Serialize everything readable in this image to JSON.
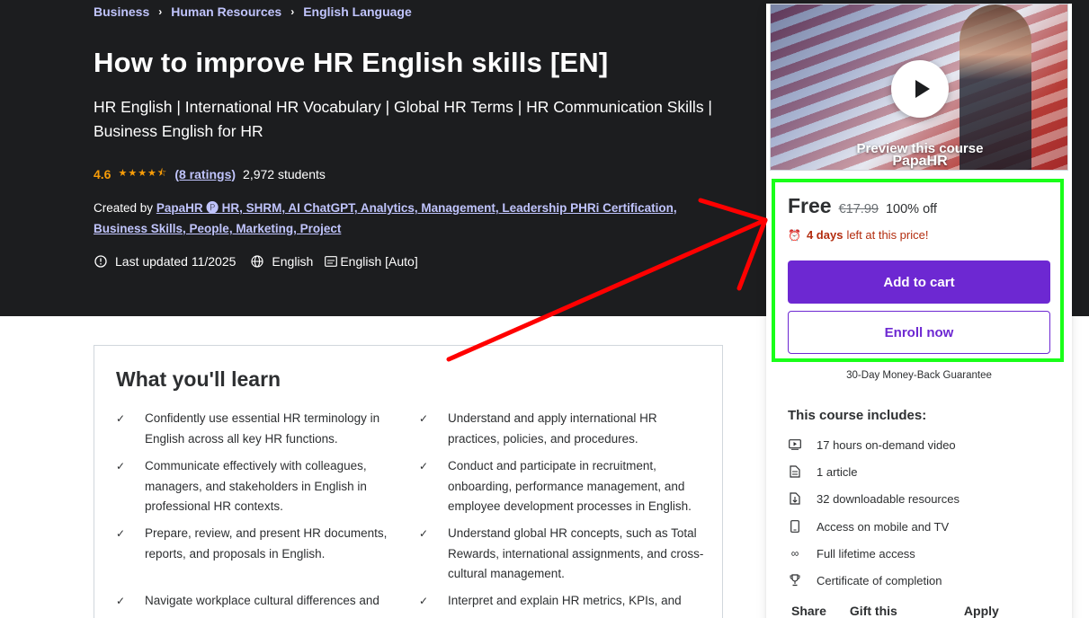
{
  "breadcrumb": [
    "Business",
    "Human Resources",
    "English Language"
  ],
  "course": {
    "title": "How to improve HR English skills [EN]",
    "subtitle": "HR English | International HR Vocabulary | Global HR Terms | HR Communication Skills | Business English for HR",
    "rating": "4.6",
    "stars": "★★★★⯪",
    "ratings_link": "(8 ratings)",
    "students": "2,972 students",
    "created_by_label": "Created by",
    "instructors": "PapaHR 🅟 HR, SHRM, AI ChatGPT, Analytics, Management, Leadership PHRi Certification, Business Skills, People, Marketing, Project",
    "last_updated": "Last updated 11/2025",
    "language": "English",
    "captions": "English [Auto]"
  },
  "learn": {
    "title": "What you'll learn",
    "items": [
      "Confidently use essential HR terminology in English across all key HR functions.",
      "Understand and apply international HR practices, policies, and procedures.",
      "Communicate effectively with colleagues, managers, and stakeholders in English in professional HR contexts.",
      "Conduct and participate in recruitment, onboarding, performance management, and employee development processes in English.",
      "Prepare, review, and present HR documents, reports, and proposals in English.",
      "Understand global HR concepts, such as Total Rewards, international assignments, and cross-cultural management.",
      "Navigate workplace cultural differences and",
      "Interpret and explain HR metrics, KPIs, and"
    ]
  },
  "sidebar": {
    "preview_label": "Preview this course",
    "brand": "PapaHR",
    "price": "Free",
    "original_price": "€17.99",
    "discount": "100% off",
    "deadline_strong": "4 days",
    "deadline_rest": "left at this price!",
    "add_to_cart": "Add to cart",
    "enroll_now": "Enroll now",
    "guarantee": "30-Day Money-Back Guarantee",
    "includes_title": "This course includes:",
    "includes": [
      "17 hours on-demand video",
      "1 article",
      "32 downloadable resources",
      "Access on mobile and TV",
      "Full lifetime access",
      "Certificate of completion"
    ],
    "footer": [
      "Share",
      "Gift this course",
      "Apply Coupon"
    ]
  },
  "colors": {
    "hero_bg": "#1c1d1f",
    "accent_purple": "#6d28d2",
    "link_lavender": "#c0c4fc",
    "star_orange": "#f69c08",
    "deadline_red": "#b32d0f",
    "annotation_green": "#19ff19",
    "annotation_red": "#ff0000"
  }
}
